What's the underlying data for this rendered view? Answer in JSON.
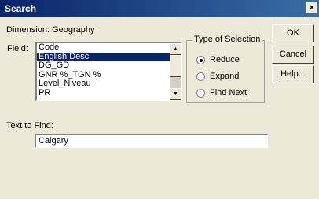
{
  "window": {
    "title": "Search",
    "close_glyph": "×"
  },
  "dimension_label": "Dimension: Geography",
  "field": {
    "label": "Field:",
    "items": [
      "Code",
      "English Desc",
      "DG_GD",
      "GNR %_TGN %",
      "Level_Niveau",
      "PR"
    ],
    "selected_index": 1
  },
  "selection_type": {
    "legend": "Type of Selection",
    "options": [
      {
        "label": "Reduce",
        "checked": true
      },
      {
        "label": "Expand",
        "checked": false
      },
      {
        "label": "Find Next",
        "checked": false
      }
    ]
  },
  "buttons": {
    "ok": "OK",
    "cancel": "Cancel",
    "help": "Help..."
  },
  "find": {
    "label": "Text to Find:",
    "value": "Calgary"
  },
  "icons": {
    "scroll_up": "scroll-up-arrow-icon",
    "scroll_down": "scroll-down-arrow-icon",
    "up_glyph": "▲",
    "down_glyph": "▼"
  }
}
